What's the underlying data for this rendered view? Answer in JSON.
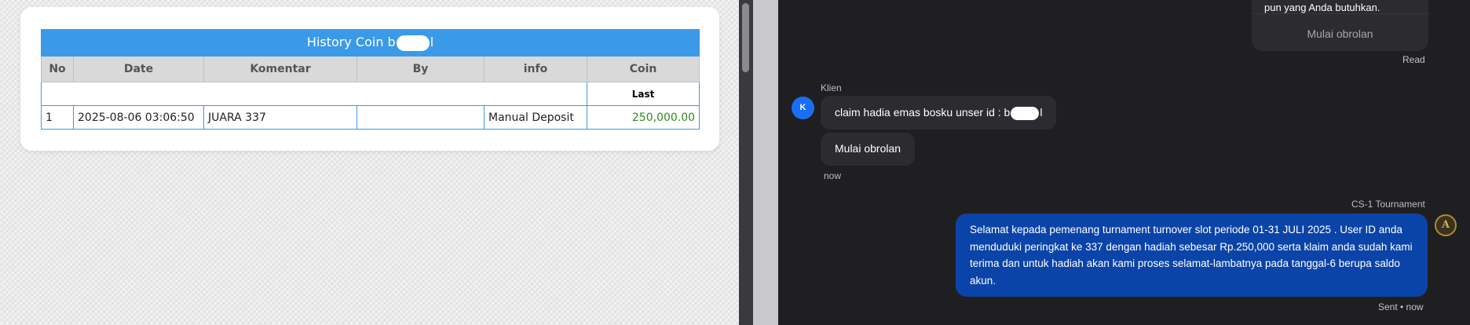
{
  "history": {
    "title_prefix": "History Coin b",
    "title_suffix": "l",
    "columns": [
      "No",
      "Date",
      "Komentar",
      "By",
      "info",
      "Coin"
    ],
    "last_label": "Last",
    "rows": [
      {
        "no": "1",
        "date": "2025-08-06 03:06:50",
        "komentar": "JUARA 337",
        "by": "",
        "info": "Manual Deposit",
        "coin": "250,000.00"
      }
    ]
  },
  "chat": {
    "top_bubble_text": "pun yang Anda butuhkan.",
    "top_bubble_action": "Mulai obrolan",
    "read_status": "Read",
    "client_name": "Klien",
    "client_avatar": "K",
    "client_msg_prefix": "claim hadia emas bosku unser id : b",
    "client_msg_suffix": "l",
    "client_action": "Mulai obrolan",
    "client_time": "now",
    "agent_name": "CS-1 Tournament",
    "agent_avatar": "A",
    "agent_message": "Selamat kepada pemenang turnament turnover slot periode 01-31 JULI 2025 . User ID anda menduduki peringkat ke 337 dengan hadiah sebesar Rp.250,000 serta klaim anda sudah kami terima dan untuk hadiah akan kami proses selamat-lambatnya pada tanggal-6 berupa saldo akun.",
    "sent_status": "Sent • now"
  },
  "colors": {
    "table_header": "#3b9ae8",
    "coin_green": "#2e8b1d",
    "agent_bubble": "#0b44a8",
    "client_avatar": "#1a6ef5",
    "chat_bg": "#1f1f22"
  }
}
